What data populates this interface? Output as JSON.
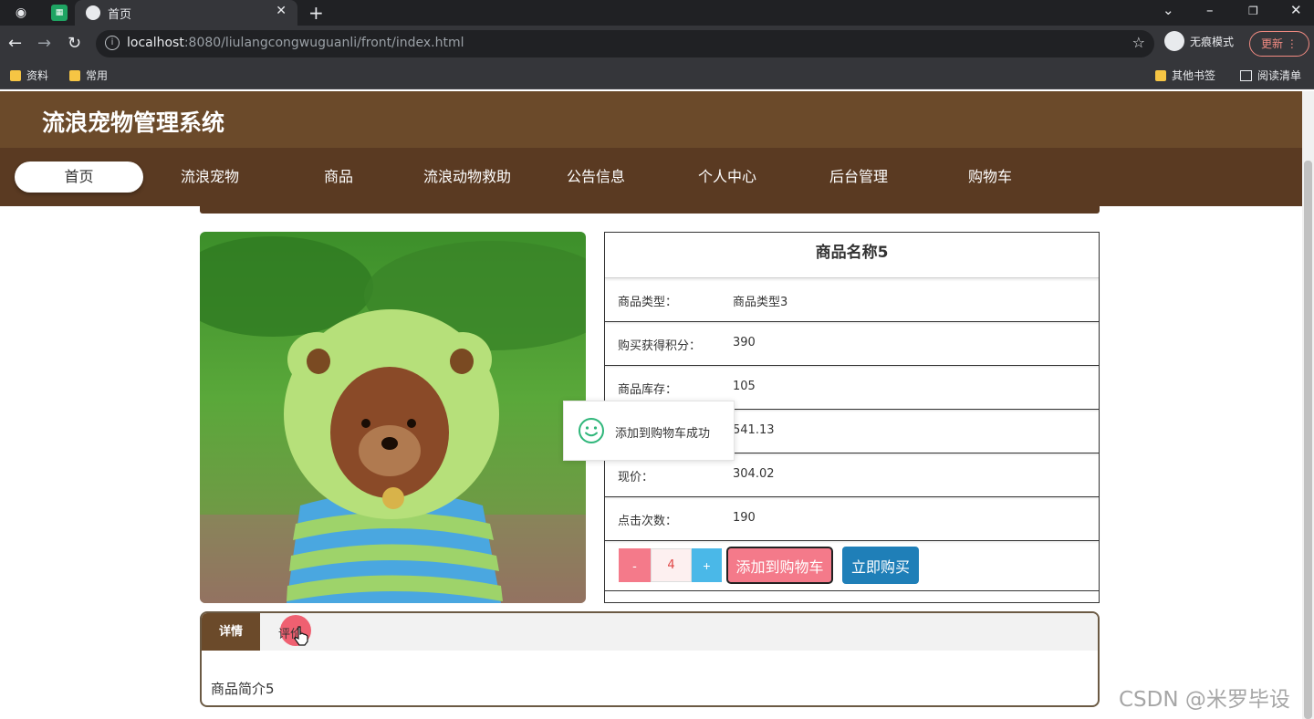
{
  "browser": {
    "tab_title": "首页",
    "url_host": "localhost",
    "url_rest": ":8080/liulangcongwuguanli/front/index.html",
    "incognito_label": "无痕模式",
    "update_label": "更新",
    "bookmarks": [
      "资料",
      "常用"
    ],
    "bookmarks_right": [
      "其他书签",
      "阅读清单"
    ]
  },
  "site": {
    "title": "流浪宠物管理系统",
    "nav": [
      "首页",
      "流浪宠物",
      "商品",
      "流浪动物救助",
      "公告信息",
      "个人中心",
      "后台管理",
      "购物车"
    ]
  },
  "product": {
    "name": "商品名称5",
    "fields": [
      {
        "label": "商品类型：",
        "value": "商品类型3"
      },
      {
        "label": "购买获得积分：",
        "value": "390"
      },
      {
        "label": "商品库存：",
        "value": "105"
      },
      {
        "label": "",
        "value": "541.13"
      },
      {
        "label": "现价：",
        "value": "304.02"
      },
      {
        "label": "点击次数：",
        "value": "190"
      }
    ],
    "quantity": "4",
    "minus_label": "-",
    "plus_label": "+",
    "add_to_cart_label": "添加到购物车",
    "buy_now_label": "立即购买"
  },
  "toast": {
    "message": "添加到购物车成功"
  },
  "tabs": {
    "detail_label": "详情",
    "review_label": "评价",
    "content": "商品简介5"
  },
  "watermark": "CSDN @米罗毕设",
  "colors": {
    "header_brown": "#6b4a2a",
    "nav_brown": "#5a3a22",
    "cart_pink": "#f47a8a",
    "buy_blue": "#1f7fb8",
    "plus_blue": "#4ab8e8",
    "toast_green": "#2fb67a"
  }
}
